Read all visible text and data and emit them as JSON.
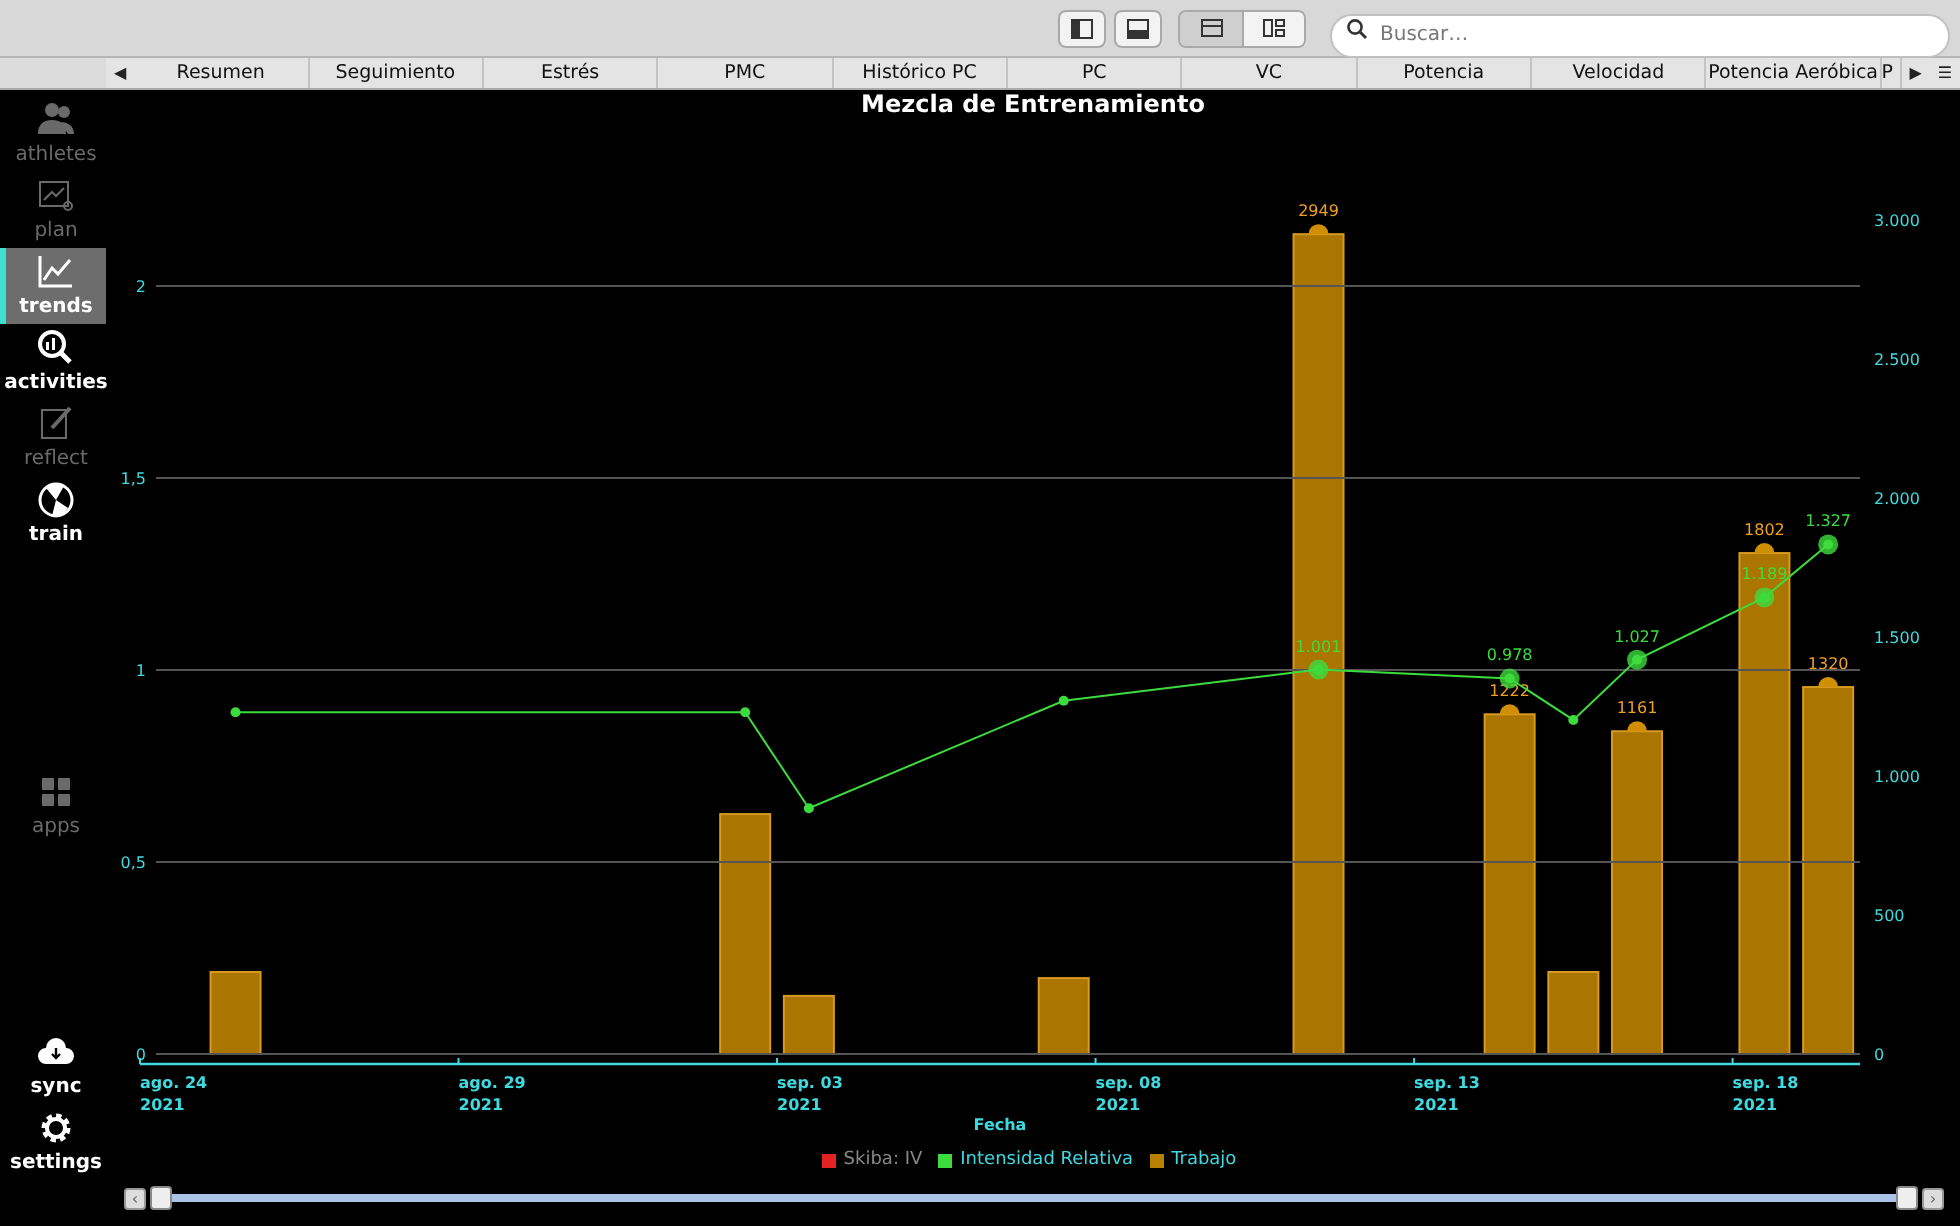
{
  "toolbar": {
    "view_buttons": [
      {
        "selected": false
      },
      {
        "selected": false
      }
    ],
    "layout_buttons": [
      {
        "selected": true
      },
      {
        "selected": false
      }
    ],
    "search": {
      "placeholder": "Buscar…"
    }
  },
  "tabs": {
    "scroll_left": "◀",
    "scroll_right": "▶",
    "menu": "☰",
    "items": [
      {
        "label": "Resumen",
        "selected": false
      },
      {
        "label": "Seguimiento",
        "selected": false
      },
      {
        "label": "Estrés",
        "selected": false
      },
      {
        "label": "PMC",
        "selected": false
      },
      {
        "label": "Histórico PC",
        "selected": false
      },
      {
        "label": "PC",
        "selected": false
      },
      {
        "label": "VC",
        "selected": false
      },
      {
        "label": "Potencia",
        "selected": false
      },
      {
        "label": "Velocidad",
        "selected": false
      },
      {
        "label": "Potencia Aeróbica",
        "selected": false
      },
      {
        "label": "P",
        "selected": false
      }
    ]
  },
  "sidebar": {
    "items": [
      {
        "kind": "athletes",
        "label": "athletes",
        "selected": false,
        "disabled": true
      },
      {
        "kind": "plan",
        "label": "plan",
        "selected": false,
        "disabled": true
      },
      {
        "kind": "trends",
        "label": "trends",
        "selected": true,
        "disabled": false
      },
      {
        "kind": "activities",
        "label": "activities",
        "selected": false,
        "disabled": false
      },
      {
        "kind": "reflect",
        "label": "reflect",
        "selected": false,
        "disabled": true
      },
      {
        "kind": "train",
        "label": "train",
        "selected": false,
        "disabled": false
      },
      {
        "kind": "apps",
        "label": "apps",
        "selected": false,
        "disabled": true
      },
      {
        "kind": "sync",
        "label": "sync",
        "selected": false,
        "disabled": false
      },
      {
        "kind": "settings",
        "label": "settings",
        "selected": false,
        "disabled": false
      }
    ]
  },
  "chart": {
    "chart_data": {
      "type": "bar",
      "title": "Mezcla de Entrenamiento",
      "xlabel": "Fecha",
      "categories": [
        "ago. 24\n2021",
        null,
        null,
        null,
        null,
        "ago. 29\n2021",
        null,
        null,
        null,
        null,
        "sep. 03\n2021",
        null,
        null,
        null,
        null,
        "sep. 08\n2021",
        null,
        null,
        null,
        null,
        "sep. 13\n2021",
        null,
        null,
        null,
        null,
        "sep. 18\n2021",
        null
      ],
      "ylim": [
        0,
        3000
      ],
      "yticks": [
        {
          "value": 0,
          "label": "0"
        },
        {
          "value": 500,
          "label": "500"
        },
        {
          "value": 1000,
          "label": "1.000"
        },
        {
          "value": 1500,
          "label": "1.500"
        },
        {
          "value": 2000,
          "label": "2.000"
        },
        {
          "value": 2500,
          "label": "2.500"
        },
        {
          "value": 3000,
          "label": "3.000"
        }
      ],
      "series": [
        {
          "name": "Trabajo",
          "color": "#b97f00",
          "values": [
            null,
            295,
            null,
            null,
            null,
            null,
            null,
            null,
            null,
            863,
            209,
            null,
            null,
            null,
            273,
            null,
            null,
            null,
            2949,
            null,
            null,
            1222,
            295,
            1161,
            null,
            1802,
            1320
          ]
        }
      ],
      "annotations": [
        {
          "y": 2949,
          "text": "2949"
        },
        {
          "y": 1222,
          "text": "1222"
        },
        {
          "y": 1161,
          "text": "1161"
        },
        {
          "y": 1802,
          "text": "1802"
        },
        {
          "y": 1320,
          "text": "1320"
        }
      ]
    }
  },
  "intensity_overlay": {
    "chart_data": {
      "type": "line",
      "grid": true,
      "ylim": [
        0,
        2
      ],
      "yticks": [
        {
          "value": 0,
          "label": "0"
        },
        {
          "value": 0.5,
          "label": "0,5"
        },
        {
          "value": 1,
          "label": "1"
        },
        {
          "value": 1.5,
          "label": "1,5"
        },
        {
          "value": 2,
          "label": "2"
        }
      ],
      "series": [
        {
          "name": "Skiba: IV",
          "color": "#e52222",
          "values": [
            null,
            null,
            null,
            null,
            null,
            null,
            null,
            null,
            null,
            null,
            null,
            null,
            null,
            null,
            null,
            null,
            null,
            null,
            null,
            null,
            null,
            null,
            null,
            null,
            null,
            null,
            null
          ]
        },
        {
          "name": "Intensidad Relativa",
          "color": "#3ddc3d",
          "marker": "circle",
          "values": [
            null,
            0.89,
            null,
            null,
            null,
            null,
            null,
            null,
            null,
            0.89,
            0.64,
            null,
            null,
            null,
            0.92,
            null,
            null,
            null,
            1.001,
            null,
            null,
            0.978,
            0.87,
            1.027,
            null,
            1.189,
            1.327
          ]
        }
      ],
      "annotations": [
        {
          "y": 1.001,
          "text": "1.001"
        },
        {
          "y": 0.978,
          "text": "0.978"
        },
        {
          "y": 1.027,
          "text": "1.027"
        },
        {
          "y": 1.189,
          "text": "1.189"
        },
        {
          "y": 1.327,
          "text": "1.327"
        }
      ]
    }
  },
  "range_slider": {
    "step_left": "‹",
    "step_right": "›"
  }
}
